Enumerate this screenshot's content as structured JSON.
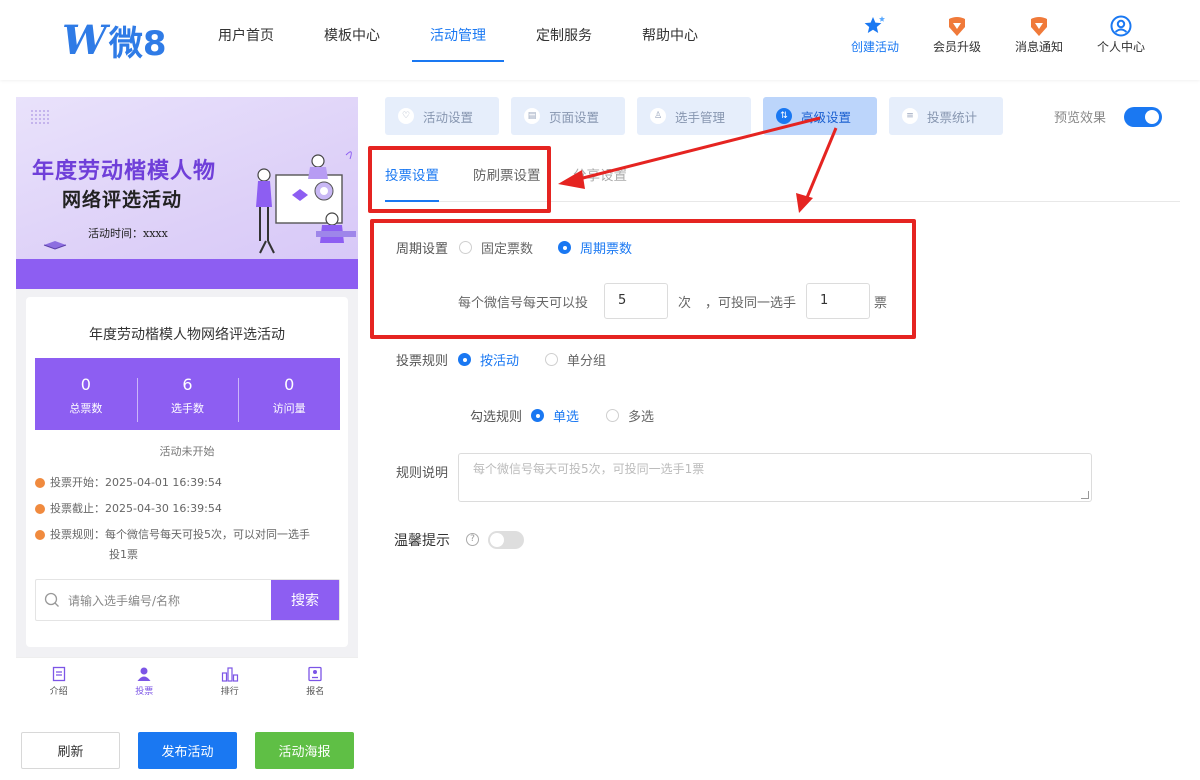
{
  "header": {
    "logo_mark": "W",
    "logo_text": "微8",
    "nav": [
      "用户首页",
      "模板中心",
      "活动管理",
      "定制服务",
      "帮助中心"
    ],
    "active_nav": 2,
    "tools": [
      {
        "label": "创建活动",
        "icon": "star-icon"
      },
      {
        "label": "会员升级",
        "icon": "diamond-icon"
      },
      {
        "label": "消息通知",
        "icon": "diamond-icon"
      },
      {
        "label": "个人中心",
        "icon": "user-icon"
      }
    ],
    "accent": "#1a78f2"
  },
  "preview": {
    "banner": {
      "title1": "年度劳动楷模人物",
      "title2": "网络评选活动",
      "time": "活动时间：xxxx"
    },
    "card_title": "年度劳动楷模人物网络评选活动",
    "stats": [
      {
        "value": "0",
        "label": "总票数"
      },
      {
        "value": "6",
        "label": "选手数"
      },
      {
        "value": "0",
        "label": "访问量"
      }
    ],
    "status": "活动未开始",
    "info": [
      "投票开始：2025-04-01 16:39:54",
      "投票截止：2025-04-30 16:39:54",
      "投票规则：每个微信号每天可投5次，可以对同一选手",
      "投1票"
    ],
    "search_placeholder": "请输入选手编号/名称",
    "search_button": "搜索",
    "tabbar": [
      "介绍",
      "投票",
      "排行",
      "报名"
    ],
    "accent": "#8d5ef2"
  },
  "actions": {
    "refresh": "刷新",
    "publish": "发布活动",
    "poster": "活动海报"
  },
  "settings": {
    "steps": [
      "活动设置",
      "页面设置",
      "选手管理",
      "高级设置",
      "投票统计"
    ],
    "active_step": 3,
    "preview_label": "预览效果",
    "preview_on": true,
    "subtabs": [
      "投票设置",
      "防刷票设置",
      "分享设置"
    ],
    "period": {
      "label": "周期设置",
      "options": [
        "固定票数",
        "周期票数"
      ],
      "selected": 1,
      "sentence_a": "每个微信号每天可以投",
      "times_value": "5",
      "sentence_b": "次",
      "sentence_c": "，可投同一选手",
      "votes_value": "1",
      "sentence_d": "票"
    },
    "rule": {
      "label": "投票规则",
      "options": [
        "按活动",
        "单分组"
      ],
      "selected": 0
    },
    "check": {
      "label": "勾选规则",
      "options": [
        "单选",
        "多选"
      ],
      "selected": 0
    },
    "desc": {
      "label": "规则说明",
      "placeholder": "每个微信号每天可投5次，可投同一选手1票"
    },
    "tip": {
      "label": "温馨提示",
      "help": "?",
      "on": false
    }
  }
}
